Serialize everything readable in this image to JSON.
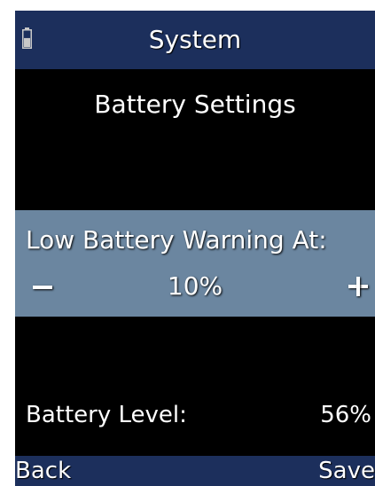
{
  "title_bar": {
    "title": "System",
    "status_icon": "battery-icon",
    "battery_fill_fraction": 0.56
  },
  "heading": "Battery Settings",
  "warning_setting": {
    "label": "Low Battery Warning At:",
    "decrement_symbol": "minus-icon",
    "value": "10%",
    "increment_symbol": "plus-icon"
  },
  "battery_level": {
    "label": "Battery Level:",
    "value": "56%"
  },
  "soft_keys": {
    "left_label": "Back",
    "right_label": "Save"
  },
  "colors": {
    "header_background": "#1c2f5c",
    "selection_background": "#6b86a0",
    "screen_background": "#000000",
    "text": "#ffffff"
  }
}
